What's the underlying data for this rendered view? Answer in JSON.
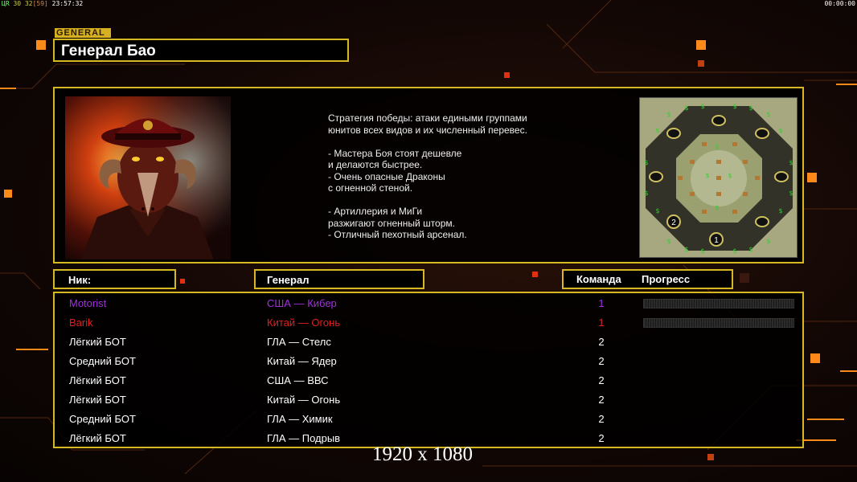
{
  "hud": {
    "left_prefix": "ЦR",
    "left_num1": "30",
    "left_num2": "32",
    "left_bracket": "[59]",
    "left_time": "23:57:32",
    "right_time": "00:00:00"
  },
  "general": {
    "tag": "GENERAL",
    "name": "Генерал Бао"
  },
  "description": [
    "Стратегия победы: атаки едиными группами",
    "юнитов всех видов и их численный перевес.",
    "",
    "- Мастера Боя стоят дешевле",
    "и делаются быстрее.",
    "- Очень опасные Драконы",
    "с огненной стеной.",
    "",
    "- Артиллерия и МиГи",
    "разжигают огненный шторм.",
    "- Отличный пехотный арсенал."
  ],
  "minimap": {
    "start_labels": [
      "2",
      "1"
    ]
  },
  "headers": {
    "nick": "Ник:",
    "general": "Генерал",
    "team": "Команда",
    "progress": "Прогресс"
  },
  "players": [
    {
      "nick": "Motorist",
      "general": "США — Кибер",
      "team": "1",
      "color": "#a030e0",
      "progress": 0
    },
    {
      "nick": "Barik",
      "general": "Китай — Огонь",
      "team": "1",
      "color": "#e02020",
      "progress": 0
    },
    {
      "nick": "Лёгкий БОТ",
      "general": "ГЛА — Стелс",
      "team": "2",
      "color": "#ffffff"
    },
    {
      "nick": "Средний БОТ",
      "general": "Китай — Ядер",
      "team": "2",
      "color": "#ffffff"
    },
    {
      "nick": "Лёгкий БОТ",
      "general": "США — ВВС",
      "team": "2",
      "color": "#ffffff"
    },
    {
      "nick": "Лёгкий БОТ",
      "general": "Китай — Огонь",
      "team": "2",
      "color": "#ffffff"
    },
    {
      "nick": "Средний БОТ",
      "general": "ГЛА — Химик",
      "team": "2",
      "color": "#ffffff"
    },
    {
      "nick": "Лёгкий БОТ",
      "general": "ГЛА — Подрыв",
      "team": "2",
      "color": "#ffffff"
    }
  ],
  "resolution_caption": "1920 x 1080",
  "colors": {
    "accent": "#d8b820",
    "bg_orange": "#ff7a1a"
  }
}
